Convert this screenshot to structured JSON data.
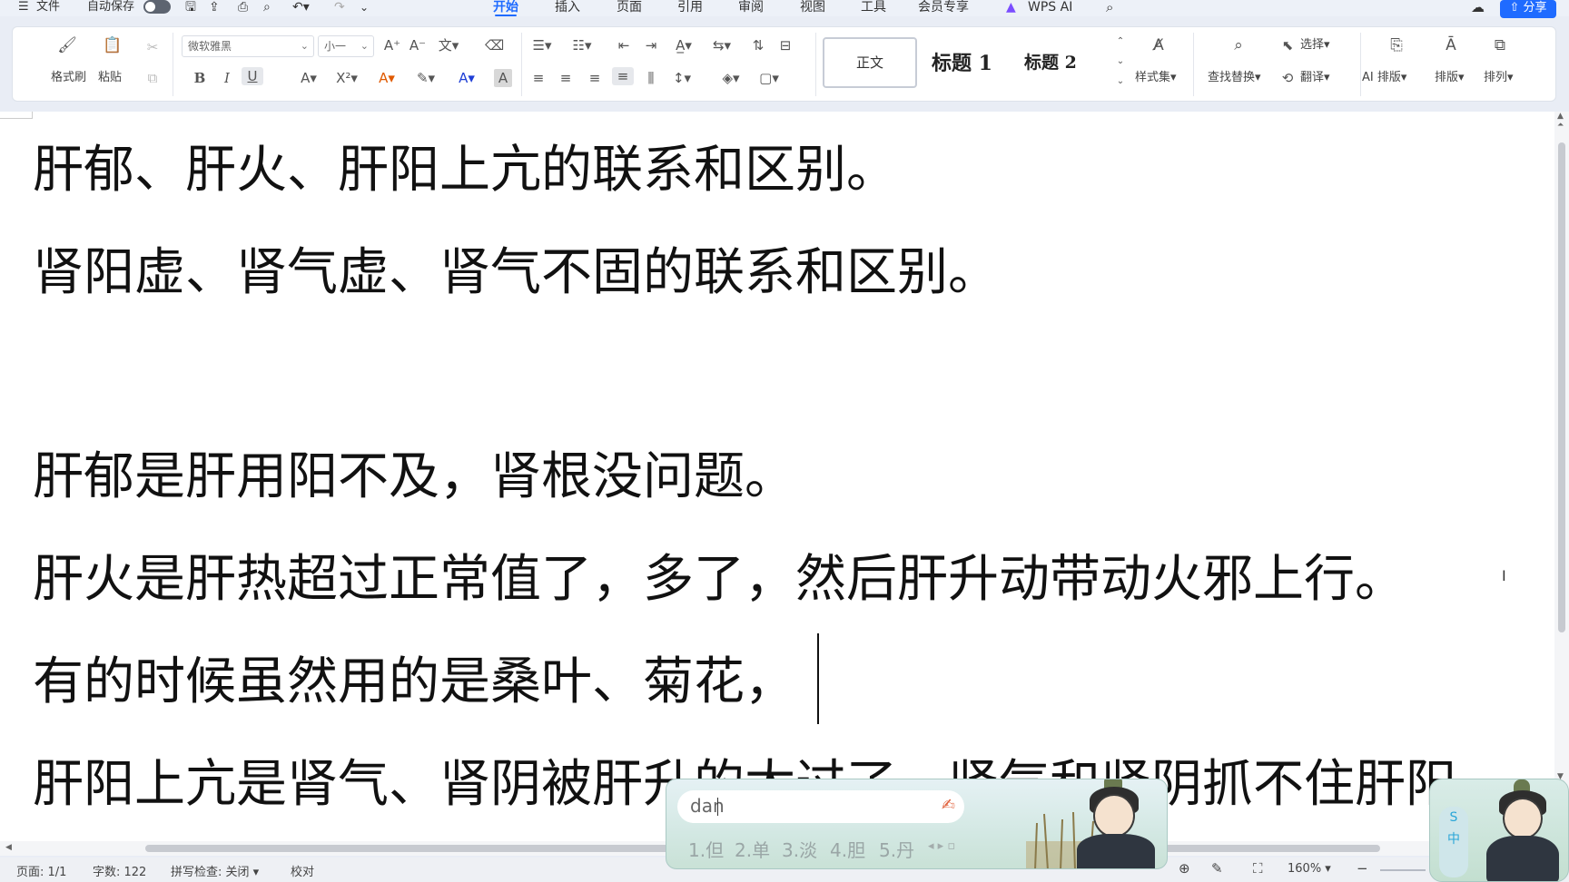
{
  "menubar": {
    "menu_icon": "☰",
    "file": "文件",
    "autosave": "自动保存",
    "tabs": [
      "开始",
      "插入",
      "页面",
      "引用",
      "审阅",
      "视图",
      "工具",
      "会员专享",
      "WPS AI"
    ],
    "active_tab": "开始",
    "share": "分享"
  },
  "ribbon": {
    "format_painter": "格式刷",
    "paste": "粘贴",
    "font_name": "微软雅黑",
    "font_size": "小一",
    "bold": "B",
    "italic": "I",
    "underline": "U",
    "styles": {
      "normal": "正文",
      "heading1": "标题 1",
      "heading2": "标题 2"
    },
    "style_set": "样式集",
    "find_replace": "查找替换",
    "select": "选择",
    "translate": "翻译",
    "ai_layout": "AI 排版",
    "layout": "排版",
    "arrange": "排列"
  },
  "document": {
    "lines": [
      "肝郁、肝火、肝阳上亢的联系和区别。",
      "肾阳虚、肾气虚、肾气不固的联系和区别。",
      "",
      "肝郁是肝用阳不及，肾根没问题。",
      "肝火是肝热超过正常值了，多了，然后肝升动带动火邪上行。",
      "有的时候虽然用的是桑叶、菊花，",
      "肝阳上亢是肾气、肾阴被肝升的太过了，肾气和肾阴抓不住肝阳"
    ]
  },
  "statusbar": {
    "page": "页面: 1/1",
    "word_count": "字数: 122",
    "spellcheck": "拼写检查: 关闭",
    "proofread": "校对",
    "zoom": "160%"
  },
  "ime": {
    "input": "dan",
    "candidates": [
      "1.但",
      "2.单",
      "3.淡",
      "4.胆",
      "5.丹"
    ]
  }
}
